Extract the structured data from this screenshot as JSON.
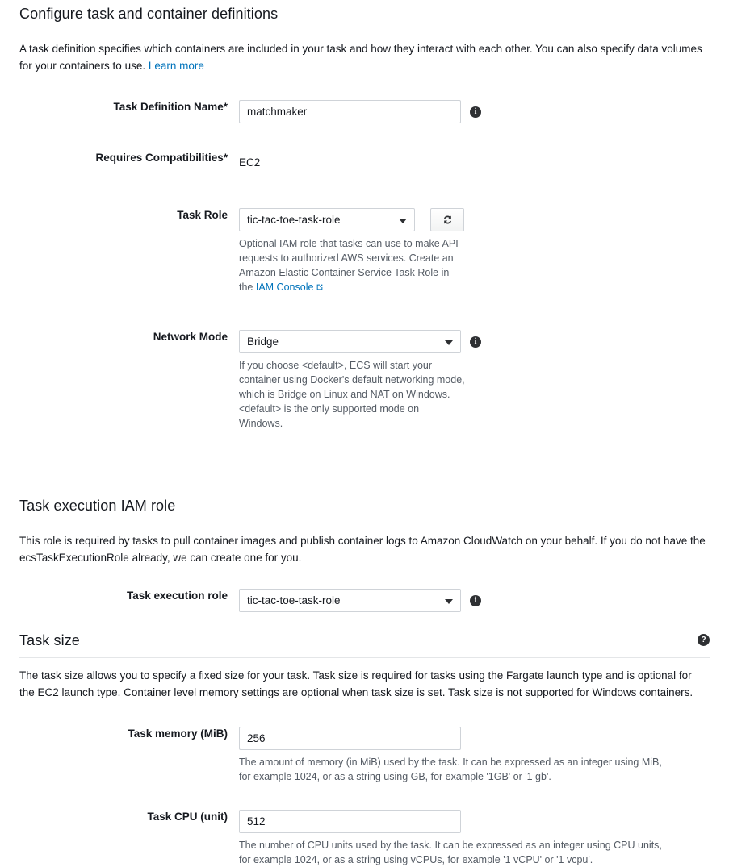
{
  "sections": {
    "configure": {
      "heading": "Configure task and container definitions",
      "intro_1": "A task definition specifies which containers are included in your task and how they interact with each other. You can also specify data volumes for your containers to use. ",
      "intro_link": "Learn more"
    },
    "exec_role": {
      "heading": "Task execution IAM role",
      "intro": "This role is required by tasks to pull container images and publish container logs to Amazon CloudWatch on your behalf. If you do not have the ecsTaskExecutionRole already, we can create one for you."
    },
    "task_size": {
      "heading": "Task size",
      "help_icon": "?",
      "intro": "The task size allows you to specify a fixed size for your task. Task size is required for tasks using the Fargate launch type and is optional for the EC2 launch type. Container level memory settings are optional when task size is set. Task size is not supported for Windows containers."
    }
  },
  "fields": {
    "task_definition_name": {
      "label": "Task Definition Name*",
      "value": "matchmaker",
      "placeholder": "",
      "info_icon": "i"
    },
    "requires_compatibilities": {
      "label": "Requires Compatibilities*",
      "value": "EC2"
    },
    "task_role": {
      "label": "Task Role",
      "value": "tic-tac-toe-task-role",
      "refresh_icon": "refresh-icon",
      "hint_text": "Optional IAM role that tasks can use to make API requests to authorized AWS services. Create an Amazon Elastic Container Service Task Role in the ",
      "hint_link": "IAM Console"
    },
    "network_mode": {
      "label": "Network Mode",
      "value": "Bridge",
      "info_icon": "i",
      "hint": "If you choose <default>, ECS will start your container using Docker's default networking mode, which is Bridge on Linux and NAT on Windows. <default> is the only supported mode on Windows."
    },
    "task_execution_role": {
      "label": "Task execution role",
      "value": "tic-tac-toe-task-role",
      "info_icon": "i"
    },
    "task_memory": {
      "label": "Task memory (MiB)",
      "value": "256",
      "hint": "The amount of memory (in MiB) used by the task. It can be expressed as an integer using MiB, for example 1024, or as a string using GB, for example '1GB' or '1 gb'."
    },
    "task_cpu": {
      "label": "Task CPU (unit)",
      "value": "512",
      "hint": "The number of CPU units used by the task. It can be expressed as an integer using CPU units, for example 1024, or as a string using vCPUs, for example '1 vCPU' or '1 vcpu'."
    }
  },
  "colors": {
    "link": "#0073bb",
    "text": "#16191f",
    "hint": "#545b64",
    "border": "#cfd3d8",
    "rule": "#e4e6e8"
  }
}
